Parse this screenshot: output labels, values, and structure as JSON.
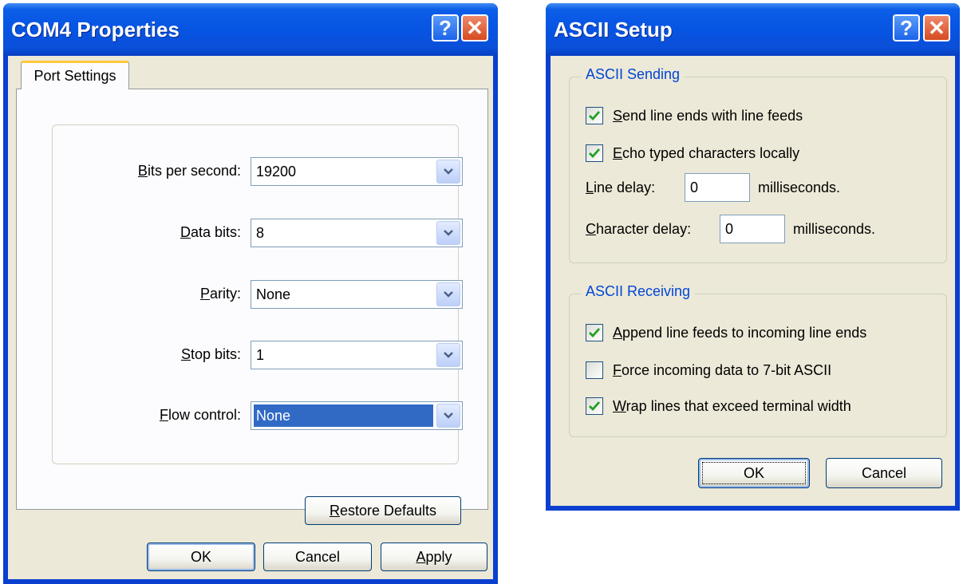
{
  "com4": {
    "title": "COM4 Properties",
    "help_glyph": "?",
    "close_glyph": "✕",
    "tab_label": "Port Settings",
    "fields": [
      {
        "label_ul": "B",
        "label_rest": "its per second:",
        "value": "19200"
      },
      {
        "label_ul": "D",
        "label_rest": "ata bits:",
        "value": "8"
      },
      {
        "label_ul": "P",
        "label_rest": "arity:",
        "value": "None"
      },
      {
        "label_ul": "S",
        "label_rest": "top bits:",
        "value": "1"
      },
      {
        "label_ul": "F",
        "label_rest": "low control:",
        "value": "None"
      }
    ],
    "restore_ul": "R",
    "restore_rest": "estore Defaults",
    "ok_label": "OK",
    "cancel_label": "Cancel",
    "apply_ul": "A",
    "apply_rest": "pply"
  },
  "ascii": {
    "title": "ASCII Setup",
    "help_glyph": "?",
    "close_glyph": "✕",
    "sending": {
      "title": "ASCII Sending",
      "checkboxes": [
        {
          "ul": "S",
          "rest": "end line ends with line feeds",
          "checked": true
        },
        {
          "ul": "E",
          "rest": "cho typed characters locally",
          "checked": true
        }
      ],
      "line_delay_ul": "L",
      "line_delay_rest": "ine delay:",
      "line_delay_value": "0",
      "char_delay_ul": "C",
      "char_delay_rest": "haracter delay:",
      "char_delay_value": "0",
      "unit": "milliseconds."
    },
    "receiving": {
      "title": "ASCII Receiving",
      "checkboxes": [
        {
          "ul": "A",
          "rest": "ppend line feeds to incoming line ends",
          "checked": true
        },
        {
          "ul": "F",
          "rest": "orce incoming data to 7-bit ASCII",
          "checked": false
        },
        {
          "ul": "W",
          "rest": "rap lines that exceed terminal width",
          "checked": true
        }
      ]
    },
    "ok_label": "OK",
    "cancel_label": "Cancel"
  },
  "colors": {
    "titlebar_blue": "#0754e3",
    "dialog_face": "#ece9d8",
    "group_title_blue": "#0046d5",
    "selection_blue": "#316ac5",
    "checkmark_green": "#21a121"
  }
}
